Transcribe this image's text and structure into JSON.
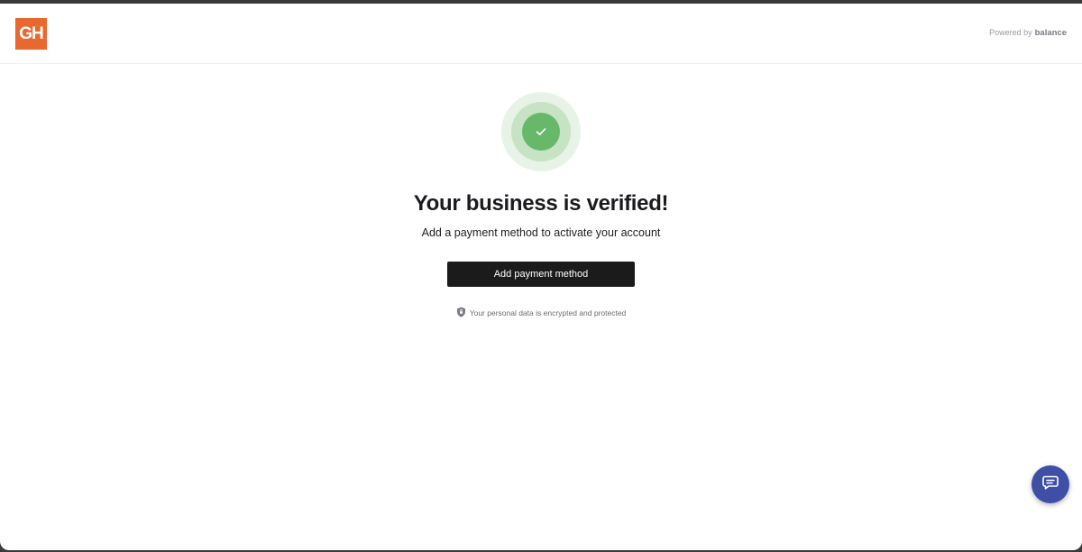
{
  "header": {
    "logo_text": "GH",
    "powered_by_label": "Powered by",
    "powered_by_brand": "balance",
    "logo_color": "#e8682f"
  },
  "main": {
    "title": "Your business is verified!",
    "subtitle": "Add a payment method to activate your account",
    "cta_label": "Add payment method",
    "security_note": "Your personal data is encrypted and protected",
    "status_icon": "check-icon",
    "security_icon": "shield-icon"
  },
  "chat": {
    "icon": "chat-icon",
    "color": "#3f4fa6"
  }
}
